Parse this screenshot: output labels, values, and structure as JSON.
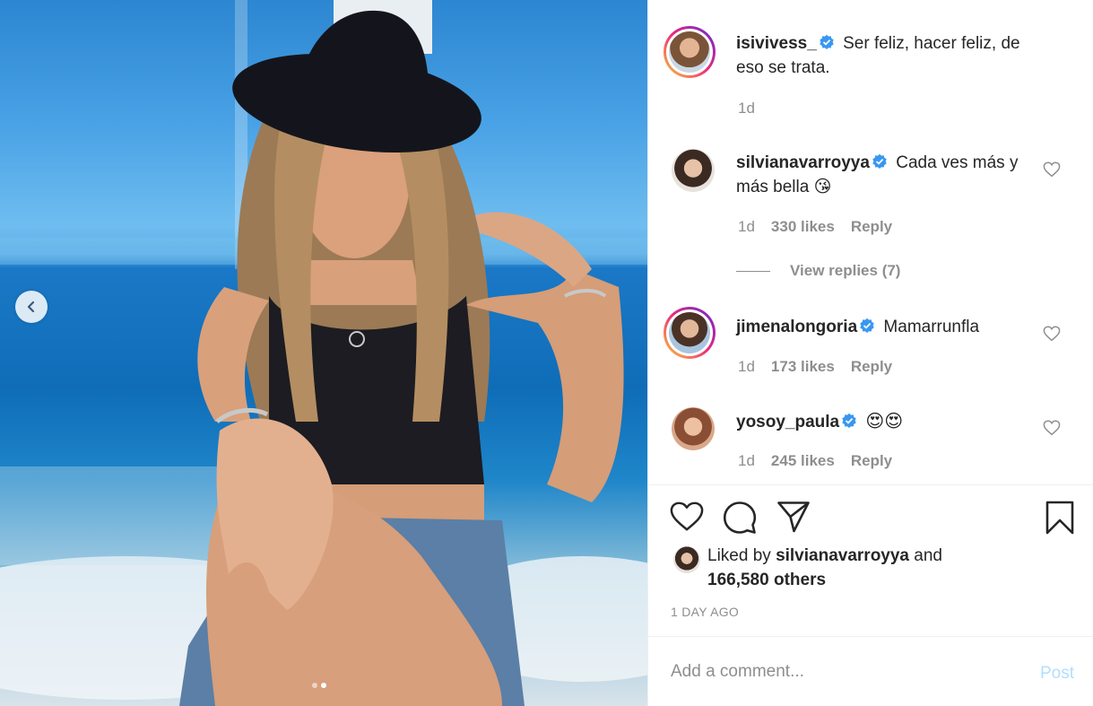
{
  "post": {
    "author": "isivivess_",
    "caption": "Ser feliz, hacer feliz, de eso se trata.",
    "time": "1d"
  },
  "carousel": {
    "slide_count": 2,
    "active_slide": 2,
    "prev_icon": "chevron-left-icon"
  },
  "comments": [
    {
      "user": "silvianavarroyya",
      "text": "Cada ves más y más bella 😘",
      "time": "1d",
      "likes": "330 likes",
      "reply": "Reply",
      "view_replies": "View replies (7)"
    },
    {
      "user": "jimenalongoria",
      "text": "Mamarrunfla",
      "time": "1d",
      "likes": "173 likes",
      "reply": "Reply"
    },
    {
      "user": "yosoy_paula",
      "text": "😍😍",
      "time": "1d",
      "likes": "245 likes",
      "reply": "Reply"
    }
  ],
  "likes": {
    "prefix": "Liked by",
    "user": "silvianavarroyya",
    "joiner": "and",
    "others": "166,580 others"
  },
  "timestamp": "1 DAY AGO",
  "composer": {
    "placeholder": "Add a comment...",
    "post_label": "Post"
  },
  "colors": {
    "verified": "#3897f0",
    "post_disabled": "#b2dffc",
    "muted": "#8e8e8e"
  }
}
